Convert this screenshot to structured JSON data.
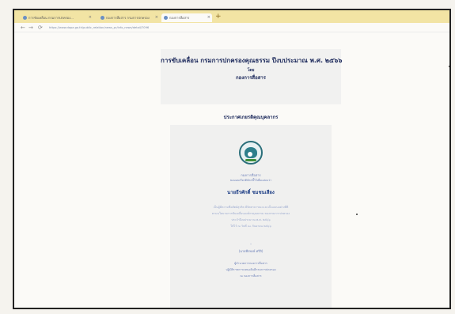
{
  "browser": {
    "tabs": [
      {
        "label": "การขับเคลื่อน กรมการปกครอง..."
      },
      {
        "label": "กองการสื่อสาร กรมการปกครอง"
      },
      {
        "label": "กองการสื่อสาร"
      }
    ],
    "new_tab_label": "+",
    "url": "https://www.dopa.go.th/public_relation/news_pr/info_news/detail/7096",
    "nav": {
      "back": "←",
      "forward": "→",
      "reload": "⟳"
    }
  },
  "page": {
    "title": "การขับเคลื่อน กรมการปกครองคุณธรรม ปีงบประมาณ พ.ศ. ๒๕๖๖",
    "by": "โดย",
    "division": "กองการสื่อสาร",
    "section_title": "ประกาศเกยรติคุณบุคลากร",
    "card": {
      "org_line1": "กองการสื่อสาร",
      "org_line2": "ขอมอบเกียรติบัตรนี้ไว้เพื่อแสดงว่า",
      "person_name": "นายธีรศักดิ์ ชมชนเสียง",
      "body": [
        "เป็นผู้มีความซื่อสัตย์สุจริต มีจิตสาธารณะและเป็นแบบอย่างที่ดี",
        "ตามนโยบายการขับเคลื่อนองค์กรคุณธรรม ของกรมการปกครอง",
        "ประจำปีงบประมาณ พ.ศ. ๒๕๖๖",
        "ให้ไว้ ณ วันที่ ๓๐ กันยายน ๒๕๖๖"
      ],
      "dash": "-",
      "ref": "(นายพีรพงษ์ ศรีลิ)",
      "signature": [
        "ผู้อำนวยการกองการสื่อสาร",
        "ปฏิบัติราชการแทนอธิบดีกรมการปกครอง",
        "ณ กองการสื่อสาร"
      ]
    }
  },
  "colors": {
    "tabbar": "#f2e4a4",
    "title": "#1d2a5c",
    "logo": "#2e7f8b"
  }
}
